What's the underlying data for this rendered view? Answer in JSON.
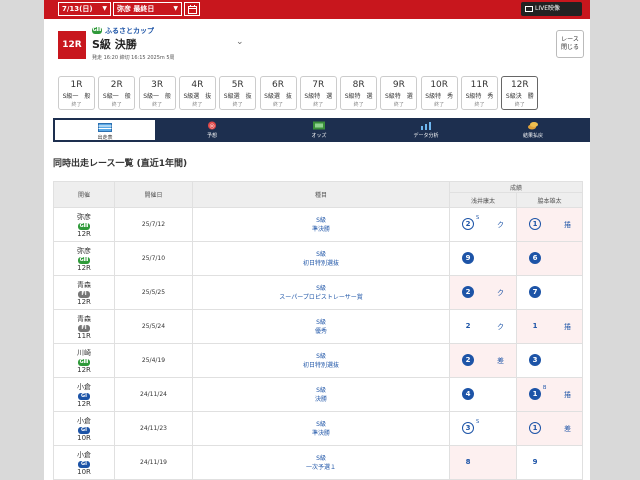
{
  "topbar": {
    "date": "7/13(日)",
    "venue": "弥彦 最終日",
    "live": "LIVE映像"
  },
  "race": {
    "badge": "12R",
    "grade": "GⅢ",
    "cup": "ふるさとカップ",
    "title": "S級 決勝",
    "meta": "発走 16:20 締切 16:15 2025m 5周",
    "close_line1": "レース",
    "close_line2": "閉じる"
  },
  "race_tabs": [
    {
      "num": "1R",
      "cls": "S級一　般",
      "status": "終了"
    },
    {
      "num": "2R",
      "cls": "S級一　般",
      "status": "終了"
    },
    {
      "num": "3R",
      "cls": "S級一　般",
      "status": "終了"
    },
    {
      "num": "4R",
      "cls": "S級選　抜",
      "status": "終了"
    },
    {
      "num": "5R",
      "cls": "S級選　抜",
      "status": "終了"
    },
    {
      "num": "6R",
      "cls": "S級選　抜",
      "status": "終了"
    },
    {
      "num": "7R",
      "cls": "S級特　選",
      "status": "終了"
    },
    {
      "num": "8R",
      "cls": "S級特　選",
      "status": "終了"
    },
    {
      "num": "9R",
      "cls": "S級特　選",
      "status": "終了"
    },
    {
      "num": "10R",
      "cls": "S級特　秀",
      "status": "終了"
    },
    {
      "num": "11R",
      "cls": "S級特　秀",
      "status": "終了"
    },
    {
      "num": "12R",
      "cls": "S級決　勝",
      "status": "終了"
    }
  ],
  "nav": [
    {
      "label": "出走表",
      "icon": "racecard-icon"
    },
    {
      "label": "予想",
      "icon": "forecast-icon"
    },
    {
      "label": "オッズ",
      "icon": "odds-icon"
    },
    {
      "label": "データ分析",
      "icon": "analysis-icon"
    },
    {
      "label": "結果払戻",
      "icon": "payout-icon"
    }
  ],
  "section_title": "同時出走レース一覧 (直近1年間)",
  "table": {
    "headers": {
      "venue": "開催",
      "date": "開催日",
      "type": "種目",
      "result": "成績",
      "rider1": "浅井康太",
      "rider2": "脇本雄太"
    },
    "rows": [
      {
        "venue": "弥彦",
        "grade": "GⅢ",
        "grade_color": "#2f9a3a",
        "race": "12R",
        "date": "25/7/12",
        "type1": "S級",
        "type2": "準決勝",
        "r1": {
          "rank": "2",
          "style": "outline",
          "sup": "S",
          "kim": "ク",
          "pink": false
        },
        "r2": {
          "rank": "1",
          "style": "outline",
          "sup": "",
          "kim": "捲",
          "pink": true
        }
      },
      {
        "venue": "弥彦",
        "grade": "GⅢ",
        "grade_color": "#2f9a3a",
        "race": "12R",
        "date": "25/7/10",
        "type1": "S級",
        "type2": "初日特別選抜",
        "r1": {
          "rank": "9",
          "style": "filled",
          "sup": "",
          "kim": "",
          "pink": false
        },
        "r2": {
          "rank": "6",
          "style": "filled",
          "sup": "",
          "kim": "",
          "pink": true
        }
      },
      {
        "venue": "青森",
        "grade": "FⅠ",
        "grade_color": "#777777",
        "race": "12R",
        "date": "25/5/25",
        "type1": "S級",
        "type2": "スーパープロピストレーサー賞",
        "r1": {
          "rank": "2",
          "style": "filled",
          "sup": "",
          "kim": "ク",
          "pink": true
        },
        "r2": {
          "rank": "7",
          "style": "filled",
          "sup": "",
          "kim": "",
          "pink": false
        }
      },
      {
        "venue": "青森",
        "grade": "FⅠ",
        "grade_color": "#777777",
        "race": "11R",
        "date": "25/5/24",
        "type1": "S級",
        "type2": "優秀",
        "r1": {
          "rank": "2",
          "style": "plain",
          "sup": "",
          "kim": "ク",
          "pink": false
        },
        "r2": {
          "rank": "1",
          "style": "plain",
          "sup": "",
          "kim": "捲",
          "pink": true
        }
      },
      {
        "venue": "川崎",
        "grade": "GⅢ",
        "grade_color": "#2f9a3a",
        "race": "12R",
        "date": "25/4/19",
        "type1": "S級",
        "type2": "初日特別選抜",
        "r1": {
          "rank": "2",
          "style": "filled",
          "sup": "",
          "kim": "差",
          "pink": true
        },
        "r2": {
          "rank": "3",
          "style": "filled",
          "sup": "",
          "kim": "",
          "pink": false
        }
      },
      {
        "venue": "小倉",
        "grade": "GⅠ",
        "grade_color": "#1d54a7",
        "race": "12R",
        "date": "24/11/24",
        "type1": "S級",
        "type2": "決勝",
        "r1": {
          "rank": "4",
          "style": "filled",
          "sup": "",
          "kim": "",
          "pink": false
        },
        "r2": {
          "rank": "1",
          "style": "filled",
          "sup": "B",
          "kim": "捲",
          "pink": true
        }
      },
      {
        "venue": "小倉",
        "grade": "GⅠ",
        "grade_color": "#1d54a7",
        "race": "10R",
        "date": "24/11/23",
        "type1": "S級",
        "type2": "準決勝",
        "r1": {
          "rank": "3",
          "style": "outline",
          "sup": "S",
          "kim": "",
          "pink": false
        },
        "r2": {
          "rank": "1",
          "style": "outline",
          "sup": "",
          "kim": "差",
          "pink": true
        }
      },
      {
        "venue": "小倉",
        "grade": "GⅠ",
        "grade_color": "#1d54a7",
        "race": "10R",
        "date": "24/11/19",
        "type1": "S級",
        "type2": "一次予選１",
        "r1": {
          "rank": "8",
          "style": "plain",
          "sup": "",
          "kim": "",
          "pink": true
        },
        "r2": {
          "rank": "9",
          "style": "plain",
          "sup": "",
          "kim": "",
          "pink": false
        }
      }
    ]
  }
}
